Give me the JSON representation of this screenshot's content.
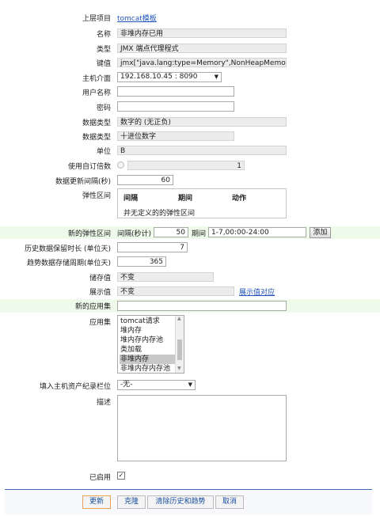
{
  "form": {
    "parent": {
      "label": "上层项目",
      "value": "tomcat模板"
    },
    "name": {
      "label": "名称",
      "value": "非堆内存已用"
    },
    "type": {
      "label": "类型",
      "value": "JMX 端点代理程式"
    },
    "key": {
      "label": "键值",
      "value": "jmx[\"java.lang:type=Memory\",NonHeapMemor"
    },
    "interface": {
      "label": "主机介面",
      "value": "192.168.10.45 : 8090"
    },
    "username": {
      "label": "用户名称",
      "value": ""
    },
    "password": {
      "label": "密码",
      "value": ""
    },
    "info_type": {
      "label": "数据类型",
      "value": "数字的 (无正负)"
    },
    "data_type": {
      "label": "数据类型",
      "value": "十进位数字"
    },
    "units": {
      "label": "单位",
      "value": "B"
    },
    "multiplier": {
      "label": "使用自订倍数",
      "value": "1"
    },
    "delay": {
      "label": "数据更新间隔(秒)",
      "value": "60"
    },
    "flex": {
      "label": "弹性区间",
      "headers": [
        "间隔",
        "期间",
        "动作"
      ],
      "empty": "并无定义的的弹性区间"
    },
    "new_flex": {
      "label": "新的弹性区间",
      "interval_label": "间隔(秒计)",
      "interval_value": "50",
      "period_label": "期间",
      "period_value": "1-7,00:00-24:00",
      "add_label": "添加"
    },
    "history": {
      "label": "历史数据保留时长 (单位天)",
      "value": "7"
    },
    "trends": {
      "label": "趋势数据存储周期(单位天)",
      "value": "365"
    },
    "store_value": {
      "label": "储存值",
      "value": "不变"
    },
    "show_value": {
      "label": "展示值",
      "value": "不变",
      "link": "展示值对应"
    },
    "new_application": {
      "label": "新的应用集",
      "value": ""
    },
    "applications": {
      "label": "应用集",
      "items": [
        "tomcat请求",
        "堆内存",
        "堆内存内存池",
        "类加载",
        "非堆内存",
        "非堆内存内存池"
      ],
      "selected_index": 4
    },
    "inventory": {
      "label": "填入主机资产纪录栏位",
      "value": "-无-"
    },
    "description": {
      "label": "描述",
      "value": ""
    },
    "enabled": {
      "label": "已启用",
      "checked": true
    }
  },
  "buttons": {
    "update": "更新",
    "clone": "克隆",
    "clear": "清除历史和趋势",
    "cancel": "取消"
  }
}
